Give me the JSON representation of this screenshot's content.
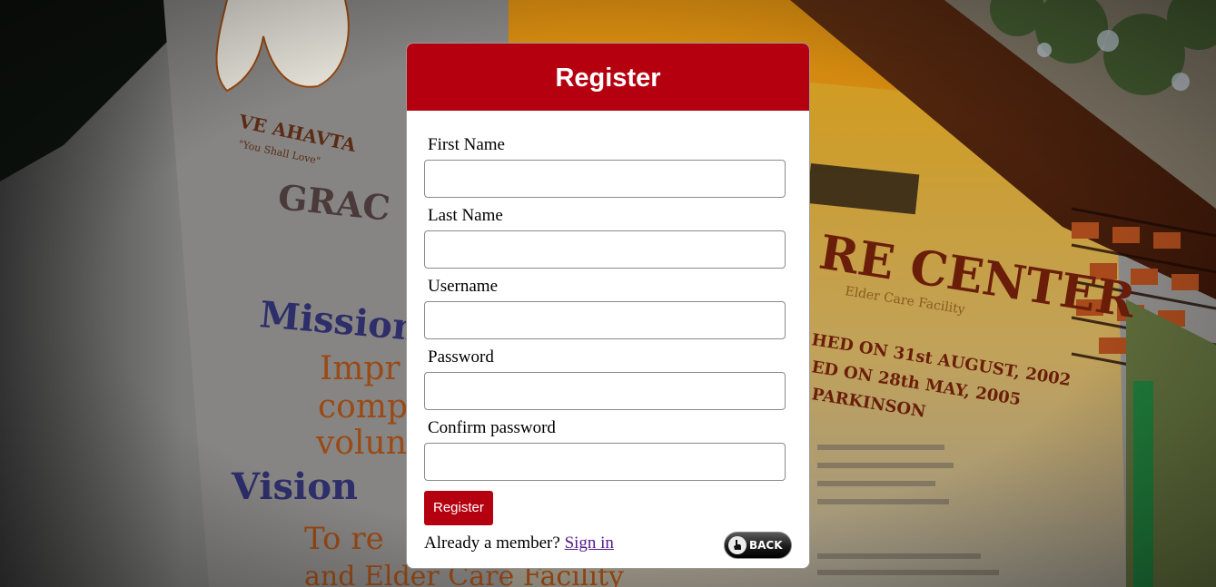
{
  "background": {
    "sign_logo_text": "Ve Ahavta",
    "sign_logo_tagline": "\"You Shall Love\"",
    "sign_heading_left": "GRAC",
    "sign_mission": "Mission",
    "sign_mission_lines": [
      "Impr",
      "comp",
      "volun"
    ],
    "sign_vision": "Vision",
    "sign_vision_lines": [
      "To re",
      "and Elder Care Facility for the benefit of a beneficial"
    ],
    "sign_heading_right": "RE CENTER",
    "sign_subheading_right": "Elder Care Facility",
    "sign_dates": [
      "HED ON 31st AUGUST, 2002",
      "ED ON 28th MAY, 2005",
      "PARKINSON"
    ]
  },
  "form": {
    "title": "Register",
    "fields": [
      {
        "label": "First Name",
        "value": "",
        "placeholder": ""
      },
      {
        "label": "Last Name",
        "value": "",
        "placeholder": ""
      },
      {
        "label": "Username",
        "value": "",
        "placeholder": ""
      },
      {
        "label": "Password",
        "value": "",
        "placeholder": ""
      },
      {
        "label": "Confirm password",
        "value": "",
        "placeholder": ""
      }
    ],
    "submit_label": "Register",
    "member_prompt": "Already a member?",
    "signin_label": "Sign in",
    "back_label": "BACK",
    "back_icon": "hand-pointer-icon"
  },
  "colors": {
    "accent": "#b5000f",
    "link": "#551a8b"
  }
}
